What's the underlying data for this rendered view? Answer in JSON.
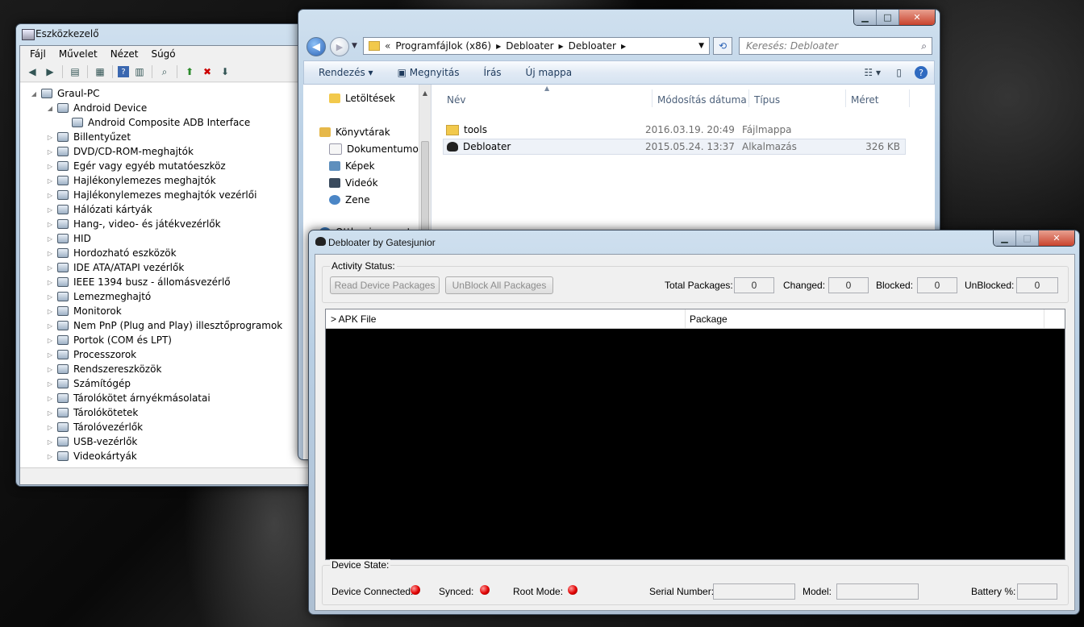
{
  "device_manager": {
    "title": "Eszközkezelő",
    "menu": [
      "Fájl",
      "Művelet",
      "Nézet",
      "Súgó"
    ],
    "tree": {
      "root": "Graul-PC",
      "expanded": "Android Device",
      "expanded_child": "Android Composite ADB Interface",
      "categories": [
        "Billentyűzet",
        "DVD/CD-ROM-meghajtók",
        "Egér vagy egyéb mutatóeszköz",
        "Hajlékonylemezes meghajtók",
        "Hajlékonylemezes meghajtók vezérlői",
        "Hálózati kártyák",
        "Hang-, video- és játékvezérlők",
        "HID",
        "Hordozható eszközök",
        "IDE ATA/ATAPI vezérlők",
        "IEEE 1394 busz - állomásvezérlő",
        "Lemezmeghajtó",
        "Monitorok",
        "Nem PnP (Plug and Play) illesztőprogramok",
        "Portok (COM és LPT)",
        "Processzorok",
        "Rendszereszközök",
        "Számítógép",
        "Tárolókötet árnyékmásolatai",
        "Tárolókötetek",
        "Tárolóvezérlők",
        "USB-vezérlők",
        "Videokártyák"
      ]
    }
  },
  "explorer": {
    "breadcrumb": [
      "Programfájlok (x86)",
      "Debloater",
      "Debloater"
    ],
    "search_placeholder": "Keresés: Debloater",
    "commands": [
      "Rendezés",
      "Megnyitás",
      "Írás",
      "Új mappa"
    ],
    "nav": {
      "downloads": "Letöltések",
      "libraries": "Könyvtárak",
      "documents": "Dokumentumok",
      "pictures": "Képek",
      "videos": "Videók",
      "music": "Zene",
      "homegroup": "Otthoni csoport"
    },
    "columns": [
      "Név",
      "Módosítás dátuma",
      "Típus",
      "Méret"
    ],
    "files": [
      {
        "name": "tools",
        "date": "2016.03.19. 20:49",
        "type": "Fájlmappa",
        "size": ""
      },
      {
        "name": "Debloater",
        "date": "2015.05.24. 13:37",
        "type": "Alkalmazás",
        "size": "326 KB"
      }
    ]
  },
  "debloater": {
    "title": "Debloater by Gatesjunior",
    "activity_label": "Activity Status:",
    "read_button": "Read Device Packages",
    "unblock_button": "UnBlock All Packages",
    "total_label": "Total Packages:",
    "total_value": "0",
    "changed_label": "Changed:",
    "changed_value": "0",
    "blocked_label": "Blocked:",
    "blocked_value": "0",
    "unblocked_label": "UnBlocked:",
    "unblocked_value": "0",
    "col_apk": "> APK File",
    "col_package": "Package",
    "device_state_label": "Device State:",
    "connected_label": "Device Connected:",
    "synced_label": "Synced:",
    "root_label": "Root Mode:",
    "serial_label": "Serial Number:",
    "serial_value": "",
    "model_label": "Model:",
    "model_value": "",
    "battery_label": "Battery %:",
    "battery_value": "",
    "led_color": "#e00000"
  }
}
